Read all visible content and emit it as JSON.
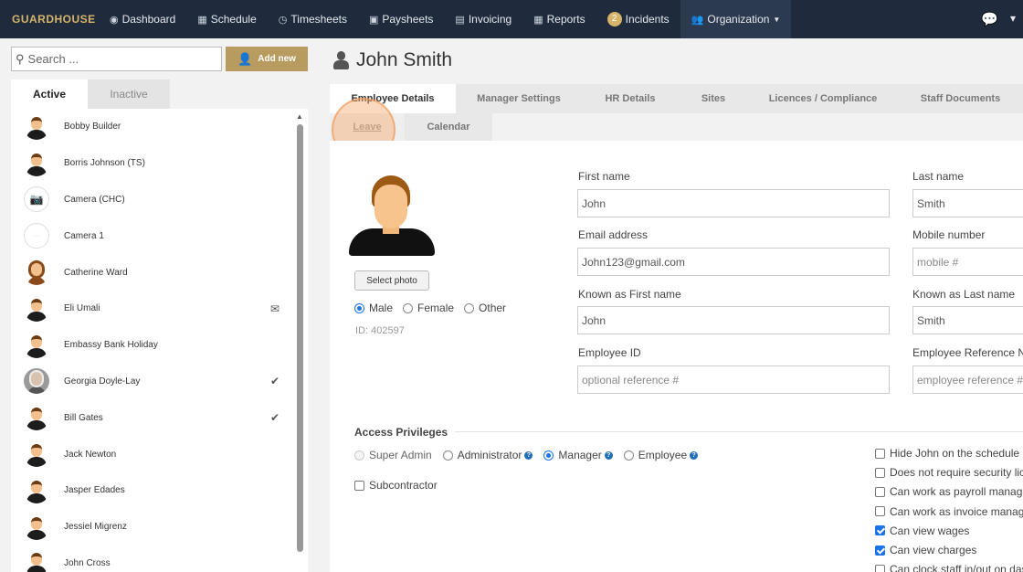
{
  "nav": {
    "brand": "GUARDHOUSE",
    "items": [
      {
        "icon": "dashboard-icon",
        "glyph": "◉",
        "label": "Dashboard"
      },
      {
        "icon": "calendar-icon",
        "glyph": "▦",
        "label": "Schedule"
      },
      {
        "icon": "clock-icon",
        "glyph": "◷",
        "label": "Timesheets"
      },
      {
        "icon": "money-icon",
        "glyph": "▣",
        "label": "Paysheets"
      },
      {
        "icon": "invoice-icon",
        "glyph": "▤",
        "label": "Invoicing"
      },
      {
        "icon": "table-icon",
        "glyph": "▦",
        "label": "Reports"
      }
    ],
    "incidents_count": "2",
    "incidents_label": "Incidents",
    "organization_label": "Organization",
    "chat_glyph": "💬"
  },
  "left": {
    "search_placeholder": "Search ...",
    "add_new_label": "Add new",
    "tab_active": "Active",
    "tab_inactive": "Inactive",
    "people": [
      {
        "name": "Bobby Builder",
        "avatar": "generic",
        "mark": ""
      },
      {
        "name": "Borris Johnson (TS)",
        "avatar": "generic",
        "mark": ""
      },
      {
        "name": "Camera (CHC)",
        "avatar": "camera",
        "mark": ""
      },
      {
        "name": "Camera 1",
        "avatar": "blank",
        "mark": ""
      },
      {
        "name": "Catherine Ward",
        "avatar": "woman",
        "mark": ""
      },
      {
        "name": "Eli Umali",
        "avatar": "generic",
        "mark": "envelope"
      },
      {
        "name": "Embassy Bank Holiday",
        "avatar": "generic",
        "mark": ""
      },
      {
        "name": "Georgia Doyle-Lay",
        "avatar": "photo",
        "mark": "check"
      },
      {
        "name": "Bill Gates",
        "avatar": "generic",
        "mark": "check"
      },
      {
        "name": "Jack Newton",
        "avatar": "generic",
        "mark": ""
      },
      {
        "name": "Jasper Edades",
        "avatar": "generic",
        "mark": ""
      },
      {
        "name": "Jessiel Migrenz",
        "avatar": "generic",
        "mark": ""
      },
      {
        "name": "John Cross",
        "avatar": "generic",
        "mark": ""
      }
    ]
  },
  "main": {
    "title": "John Smith",
    "tabs": [
      "Employee Details",
      "Manager Settings",
      "HR Details",
      "Sites",
      "Licences / Compliance",
      "Staff Documents"
    ],
    "subtabs": [
      "Leave",
      "Calendar"
    ],
    "select_photo_label": "Select photo",
    "gender": {
      "options": [
        "Male",
        "Female",
        "Other"
      ],
      "selected": "Male"
    },
    "employee_id_text": "ID: 402597",
    "fields": {
      "first_name_label": "First name",
      "first_name_value": "John",
      "last_name_label": "Last name",
      "last_name_value": "Smith",
      "email_label": "Email address",
      "email_value": "John123@gmail.com",
      "mobile_label": "Mobile number",
      "mobile_placeholder": "mobile #",
      "known_first_label": "Known as First name",
      "known_first_value": "John",
      "known_last_label": "Known as Last name",
      "known_last_value": "Smith",
      "employee_id_label": "Employee ID",
      "employee_id_placeholder": "optional reference #",
      "employee_ref_label": "Employee Reference Nu",
      "employee_ref_placeholder": "employee reference #"
    },
    "access": {
      "heading": "Access Privileges",
      "options": [
        "Super Admin",
        "Administrator",
        "Manager",
        "Employee"
      ],
      "selected": "Manager",
      "subcontractor_label": "Subcontractor"
    },
    "settings": [
      {
        "label": "Hide John on the schedule",
        "checked": false
      },
      {
        "label": "Does not require security lice",
        "checked": false
      },
      {
        "label": "Can work as payroll manage",
        "checked": false
      },
      {
        "label": "Can work as invoice manage",
        "checked": false
      },
      {
        "label": "Can view wages",
        "checked": true
      },
      {
        "label": "Can view charges",
        "checked": true
      },
      {
        "label": "Can clock staff in/out on dash",
        "checked": false
      }
    ]
  }
}
